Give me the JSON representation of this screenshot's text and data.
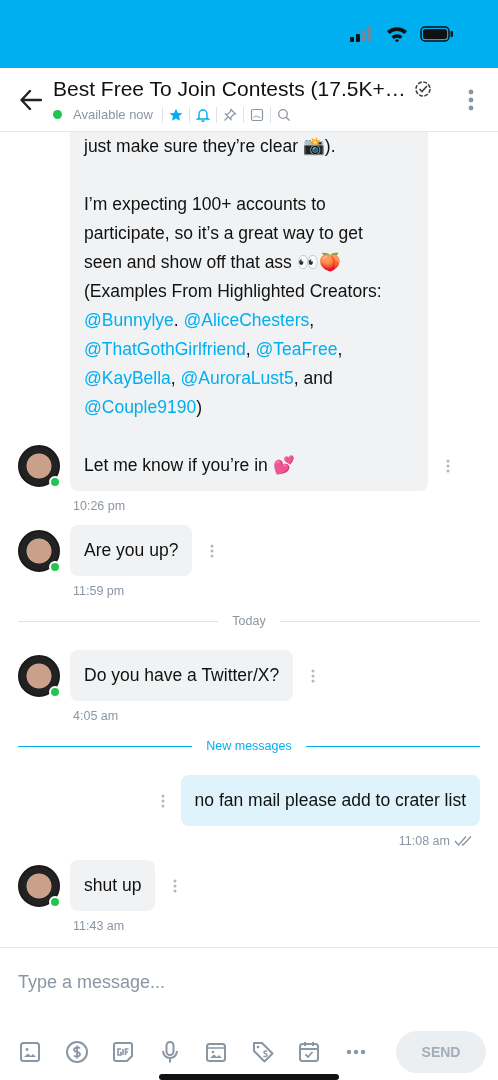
{
  "header": {
    "title": "Best Free To Join Contests (17.5K+…",
    "verified": true,
    "status": "Available now",
    "online": true,
    "tools": [
      {
        "kind": "star",
        "active": true
      },
      {
        "kind": "bell",
        "active": true
      },
      {
        "kind": "pin",
        "active": false
      },
      {
        "kind": "image",
        "active": false
      },
      {
        "kind": "search",
        "active": false
      }
    ]
  },
  "messages": [
    {
      "kind": "incoming",
      "online": true,
      "time": "10:26 pm",
      "paragraphs": [
        [
          {
            "kind": "text",
            "text": "just make sure they’re clear 📸)."
          }
        ],
        [
          {
            "kind": "text",
            "text": "I’m expecting 100+ accounts to participate, so it’s a great way to get seen and show off that ass 👀🍑 (Examples From Highlighted Creators: "
          },
          {
            "kind": "mention",
            "text": "@Bunnylye"
          },
          {
            "kind": "text",
            "text": ". "
          },
          {
            "kind": "mention",
            "text": "@AliceChesters"
          },
          {
            "kind": "text",
            "text": ", "
          },
          {
            "kind": "mention",
            "text": "@ThatGothGirlfriend"
          },
          {
            "kind": "text",
            "text": ", "
          },
          {
            "kind": "mention",
            "text": "@TeaFree"
          },
          {
            "kind": "text",
            "text": ", "
          },
          {
            "kind": "mention",
            "text": "@KayBella"
          },
          {
            "kind": "text",
            "text": ", "
          },
          {
            "kind": "mention",
            "text": "@AuroraLust5"
          },
          {
            "kind": "text",
            "text": ", and "
          },
          {
            "kind": "mention",
            "text": "@Couple9190"
          },
          {
            "kind": "text",
            "text": ")"
          }
        ],
        [
          {
            "kind": "text",
            "text": "Let me know if you’re in 💕"
          }
        ]
      ]
    },
    {
      "kind": "incoming",
      "online": true,
      "time": "11:59 pm",
      "paragraphs": [
        [
          {
            "kind": "text",
            "text": "Are you up?"
          }
        ]
      ]
    },
    {
      "kind": "divider",
      "label": "Today",
      "highlight": false
    },
    {
      "kind": "incoming",
      "online": true,
      "time": "4:05 am",
      "paragraphs": [
        [
          {
            "kind": "text",
            "text": "Do you have a Twitter/X?"
          }
        ]
      ]
    },
    {
      "kind": "divider",
      "label": "New messages",
      "highlight": true
    },
    {
      "kind": "outgoing",
      "time": "11:08 am",
      "read": true,
      "paragraphs": [
        [
          {
            "kind": "text",
            "text": "no fan mail please add to crater list"
          }
        ]
      ]
    },
    {
      "kind": "incoming",
      "online": true,
      "time": "11:43 am",
      "paragraphs": [
        [
          {
            "kind": "text",
            "text": "shut up"
          }
        ]
      ]
    }
  ],
  "composer": {
    "placeholder": "Type a message...",
    "tools": [
      {
        "kind": "image"
      },
      {
        "kind": "dollar"
      },
      {
        "kind": "gif"
      },
      {
        "kind": "mic"
      },
      {
        "kind": "vault"
      },
      {
        "kind": "tag"
      },
      {
        "kind": "calendar"
      },
      {
        "kind": "more"
      }
    ],
    "send": {
      "label": "SEND",
      "disabled": true
    }
  }
}
